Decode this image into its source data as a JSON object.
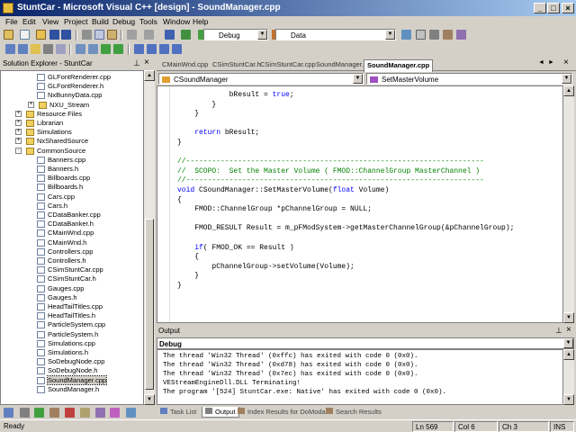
{
  "window": {
    "title": "StuntCar - Microsoft Visual C++ [design] - SoundManager.cpp"
  },
  "menu": [
    "File",
    "Edit",
    "View",
    "Project",
    "Build",
    "Debug",
    "Tools",
    "Window",
    "Help"
  ],
  "toolbar": {
    "config": "Debug",
    "find": "Data"
  },
  "solution": {
    "header": "Solution Explorer - StuntCar",
    "items": [
      {
        "label": "GLFontRenderer.cpp",
        "type": "file",
        "depth": 3
      },
      {
        "label": "GLFontRenderer.h",
        "type": "file",
        "depth": 3
      },
      {
        "label": "NxBunnyData.cpp",
        "type": "file",
        "depth": 3
      },
      {
        "label": "NXU_Stream",
        "type": "folder",
        "depth": 3,
        "exp": "+"
      },
      {
        "label": "Resource Files",
        "type": "folder",
        "depth": 1,
        "exp": "+"
      },
      {
        "label": "Librarian",
        "type": "folder",
        "depth": 1,
        "exp": "+"
      },
      {
        "label": "Simulations",
        "type": "folder",
        "depth": 1,
        "exp": "+"
      },
      {
        "label": "NxSharedSource",
        "type": "folder",
        "depth": 1,
        "exp": "+"
      },
      {
        "label": "CommonSource",
        "type": "folder",
        "depth": 1,
        "exp": "-"
      },
      {
        "label": "Banners.cpp",
        "type": "file",
        "depth": 2
      },
      {
        "label": "Banners.h",
        "type": "file",
        "depth": 2
      },
      {
        "label": "Billboards.cpp",
        "type": "file",
        "depth": 2
      },
      {
        "label": "Billboards.h",
        "type": "file",
        "depth": 2
      },
      {
        "label": "Cars.cpp",
        "type": "file",
        "depth": 2
      },
      {
        "label": "Cars.h",
        "type": "file",
        "depth": 2
      },
      {
        "label": "CDataBanker.cpp",
        "type": "file",
        "depth": 2
      },
      {
        "label": "CDataBanker.h",
        "type": "file",
        "depth": 2
      },
      {
        "label": "CMainWnd.cpp",
        "type": "file",
        "depth": 2
      },
      {
        "label": "CMainWnd.h",
        "type": "file",
        "depth": 2
      },
      {
        "label": "Controllers.cpp",
        "type": "file",
        "depth": 2
      },
      {
        "label": "Controllers.h",
        "type": "file",
        "depth": 2
      },
      {
        "label": "CSimStuntCar.cpp",
        "type": "file",
        "depth": 2
      },
      {
        "label": "CSimStuntCar.h",
        "type": "file",
        "depth": 2
      },
      {
        "label": "Gauges.cpp",
        "type": "file",
        "depth": 2
      },
      {
        "label": "Gauges.h",
        "type": "file",
        "depth": 2
      },
      {
        "label": "HeadTailTitles.cpp",
        "type": "file",
        "depth": 2
      },
      {
        "label": "HeadTailTitles.h",
        "type": "file",
        "depth": 2
      },
      {
        "label": "ParticleSystem.cpp",
        "type": "file",
        "depth": 2
      },
      {
        "label": "ParticleSystem.h",
        "type": "file",
        "depth": 2
      },
      {
        "label": "Simulations.cpp",
        "type": "file",
        "depth": 2
      },
      {
        "label": "Simulations.h",
        "type": "file",
        "depth": 2
      },
      {
        "label": "SoDebugNode.cpp",
        "type": "file",
        "depth": 2
      },
      {
        "label": "SoDebugNode.h",
        "type": "file",
        "depth": 2
      },
      {
        "label": "SoundManager.cpp",
        "type": "file",
        "depth": 2,
        "selected": true
      },
      {
        "label": "SoundManager.h",
        "type": "file",
        "depth": 2
      }
    ]
  },
  "tabs": [
    "CMainWnd.cpp",
    "CSimStuntCar.h",
    "CSimStuntCar.cpp",
    "SoundManager.h",
    "SoundManager.cpp"
  ],
  "nav": {
    "left": "CSoundManager",
    "right": "SetMasterVolume"
  },
  "code": [
    {
      "t": "            bResult = true;",
      "kw": "true"
    },
    {
      "t": "        }"
    },
    {
      "t": "    }"
    },
    {
      "t": ""
    },
    {
      "t": "    return bResult;",
      "kw": "return"
    },
    {
      "t": "}"
    },
    {
      "t": ""
    },
    {
      "t": "//---------------------------------------------------------------------",
      "c": 1
    },
    {
      "t": "//  SCOPO:  Set the Master Volume ( FMOD::ChannelGroup MasterChannel )",
      "c": 1
    },
    {
      "t": "//---------------------------------------------------------------------",
      "c": 1
    },
    {
      "t": "void CSoundManager::SetMasterVolume(float Volume)",
      "kw2": [
        "void",
        "float"
      ]
    },
    {
      "t": "{"
    },
    {
      "t": "    FMOD::ChannelGroup *pChannelGroup = NULL;"
    },
    {
      "t": ""
    },
    {
      "t": "    FMOD_RESULT Result = m_pFModSystem->getMasterChannelGroup(&pChannelGroup);"
    },
    {
      "t": ""
    },
    {
      "t": "    if( FMOD_OK == Result )",
      "kw": "if"
    },
    {
      "t": "    {"
    },
    {
      "t": "        pChannelGroup->setVolume(Volume);"
    },
    {
      "t": "    }"
    },
    {
      "t": "}"
    }
  ],
  "output": {
    "title": "Output",
    "pane": "Debug",
    "lines": [
      "The thread 'Win32 Thread' (0xffc) has exited with code 0 (0x0).",
      "The thread 'Win32 Thread' (0xd78) has exited with code 0 (0x0).",
      "The thread 'Win32 Thread' (0x7ec) has exited with code 0 (0x0).",
      "VEStreamEngineDll.DLL Terminating!",
      "The program '[524] StuntCar.exe: Native' has exited with code 0 (0x0)."
    ]
  },
  "bottom_tabs": [
    "Task List",
    "Output",
    "Index Results for DoModal",
    "Search Results"
  ],
  "status": {
    "ready": "Ready",
    "ln": "Ln 569",
    "col": "Col 6",
    "ch": "Ch 3",
    "mode": "INS"
  }
}
